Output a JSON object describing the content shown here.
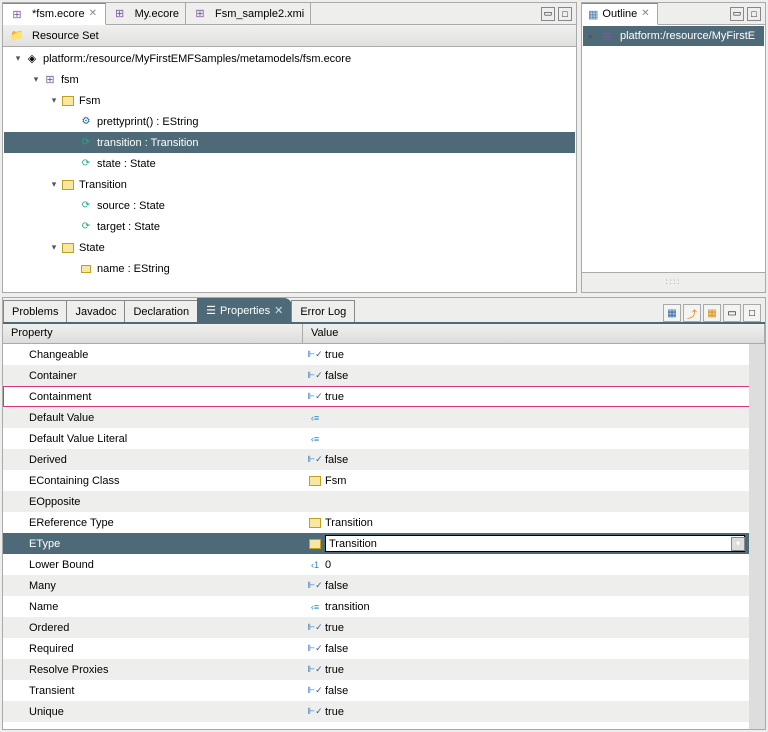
{
  "editor": {
    "tabs": [
      {
        "label": "*fsm.ecore",
        "active": true
      },
      {
        "label": "My.ecore",
        "active": false
      },
      {
        "label": "Fsm_sample2.xmi",
        "active": false
      }
    ],
    "resource_set_label": "Resource Set",
    "tree": [
      {
        "indent": 0,
        "expand": "▾",
        "icon": "file",
        "label": "platform:/resource/MyFirstEMFSamples/metamodels/fsm.ecore",
        "selected": false
      },
      {
        "indent": 1,
        "expand": "▾",
        "icon": "pkg",
        "label": "fsm",
        "selected": false
      },
      {
        "indent": 2,
        "expand": "▾",
        "icon": "class",
        "label": "Fsm",
        "selected": false
      },
      {
        "indent": 3,
        "expand": "",
        "icon": "op",
        "label": "prettyprint() : EString",
        "selected": false
      },
      {
        "indent": 3,
        "expand": "",
        "icon": "ref",
        "label": "transition : Transition",
        "selected": true
      },
      {
        "indent": 3,
        "expand": "",
        "icon": "ref",
        "label": "state : State",
        "selected": false
      },
      {
        "indent": 2,
        "expand": "▾",
        "icon": "class",
        "label": "Transition",
        "selected": false
      },
      {
        "indent": 3,
        "expand": "",
        "icon": "ref",
        "label": "source : State",
        "selected": false
      },
      {
        "indent": 3,
        "expand": "",
        "icon": "ref",
        "label": "target : State",
        "selected": false
      },
      {
        "indent": 2,
        "expand": "▾",
        "icon": "class",
        "label": "State",
        "selected": false
      },
      {
        "indent": 3,
        "expand": "",
        "icon": "attr",
        "label": "name : EString",
        "selected": false
      }
    ]
  },
  "outline": {
    "title": "Outline",
    "item": "platform:/resource/MyFirstE"
  },
  "bottom": {
    "tabs": [
      {
        "label": "Problems",
        "active": false
      },
      {
        "label": "Javadoc",
        "active": false
      },
      {
        "label": "Declaration",
        "active": false
      },
      {
        "label": "Properties",
        "active": true
      },
      {
        "label": "Error Log",
        "active": false
      }
    ],
    "headers": {
      "property": "Property",
      "value": "Value"
    },
    "rows": [
      {
        "name": "Changeable",
        "value": "true",
        "vtype": "bool"
      },
      {
        "name": "Container",
        "value": "false",
        "vtype": "bool"
      },
      {
        "name": "Containment",
        "value": "true",
        "vtype": "bool",
        "highlighted": true
      },
      {
        "name": "Default Value",
        "value": "",
        "vtype": "text"
      },
      {
        "name": "Default Value Literal",
        "value": "",
        "vtype": "text"
      },
      {
        "name": "Derived",
        "value": "false",
        "vtype": "bool"
      },
      {
        "name": "EContaining Class",
        "value": "Fsm",
        "vtype": "class"
      },
      {
        "name": "EOpposite",
        "value": "",
        "vtype": "none"
      },
      {
        "name": "EReference Type",
        "value": "Transition",
        "vtype": "class"
      },
      {
        "name": "EType",
        "value": "Transition",
        "vtype": "class",
        "selected": true,
        "editing": true
      },
      {
        "name": "Lower Bound",
        "value": "0",
        "vtype": "int"
      },
      {
        "name": "Many",
        "value": "false",
        "vtype": "bool"
      },
      {
        "name": "Name",
        "value": "transition",
        "vtype": "text"
      },
      {
        "name": "Ordered",
        "value": "true",
        "vtype": "bool"
      },
      {
        "name": "Required",
        "value": "false",
        "vtype": "bool"
      },
      {
        "name": "Resolve Proxies",
        "value": "true",
        "vtype": "bool"
      },
      {
        "name": "Transient",
        "value": "false",
        "vtype": "bool"
      },
      {
        "name": "Unique",
        "value": "true",
        "vtype": "bool"
      }
    ]
  }
}
